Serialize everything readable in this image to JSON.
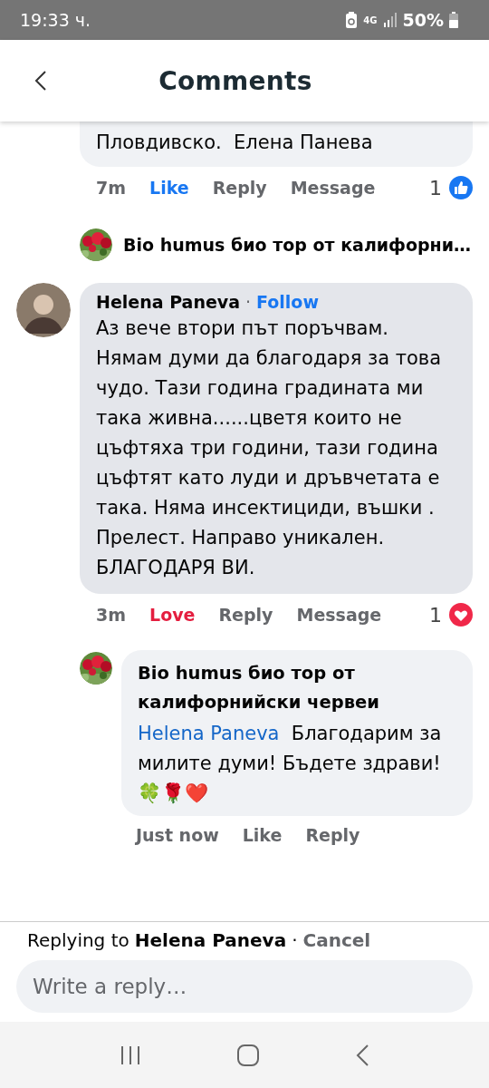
{
  "status_bar": {
    "time": "19:33 ч.",
    "network": "4G",
    "battery": "50%"
  },
  "header": {
    "title": "Comments"
  },
  "thread": [
    {
      "kind": "tail",
      "text": "Пловдивско.  Елена Панева",
      "actions": {
        "time": "7m",
        "reaction": {
          "label": "Like",
          "kind": "like"
        },
        "reply": "Reply",
        "message": "Message",
        "count": {
          "value": "1",
          "kind": "like"
        }
      }
    },
    {
      "kind": "preview",
      "author": "Bio humus био тор от калифорни…"
    },
    {
      "kind": "comment",
      "author": "Helena Paneva",
      "separator": "·",
      "follow": "Follow",
      "text": "Аз вече втори път поръчвам. Нямам думи да благодаря за това чудо. Тази година градината ми така живна......цветя които не цъфтяха три години, тази година цъфтят като луди и дръвчетата е така. Няма инсектициди, въшки . Прелест. Направо уникален. БЛАГОДАРЯ ВИ.",
      "actions": {
        "time": "3m",
        "reaction": {
          "label": "Love",
          "kind": "love"
        },
        "reply": "Reply",
        "message": "Message",
        "count": {
          "value": "1",
          "kind": "love"
        }
      }
    },
    {
      "kind": "reply",
      "author": "Bio humus био тор от калифорнийски червеи",
      "mention": "Helena Paneva",
      "text": "  Благодарим за милите думи! Бъдете здрави!🍀🌹❤️",
      "actions": {
        "time": "Just now",
        "reaction": {
          "label": "Like",
          "kind": "none"
        },
        "reply": "Reply"
      }
    }
  ],
  "composer": {
    "prefix": "Replying to",
    "name": "Helena Paneva",
    "separator": "·",
    "cancel": "Cancel",
    "placeholder": "Write a reply…"
  }
}
